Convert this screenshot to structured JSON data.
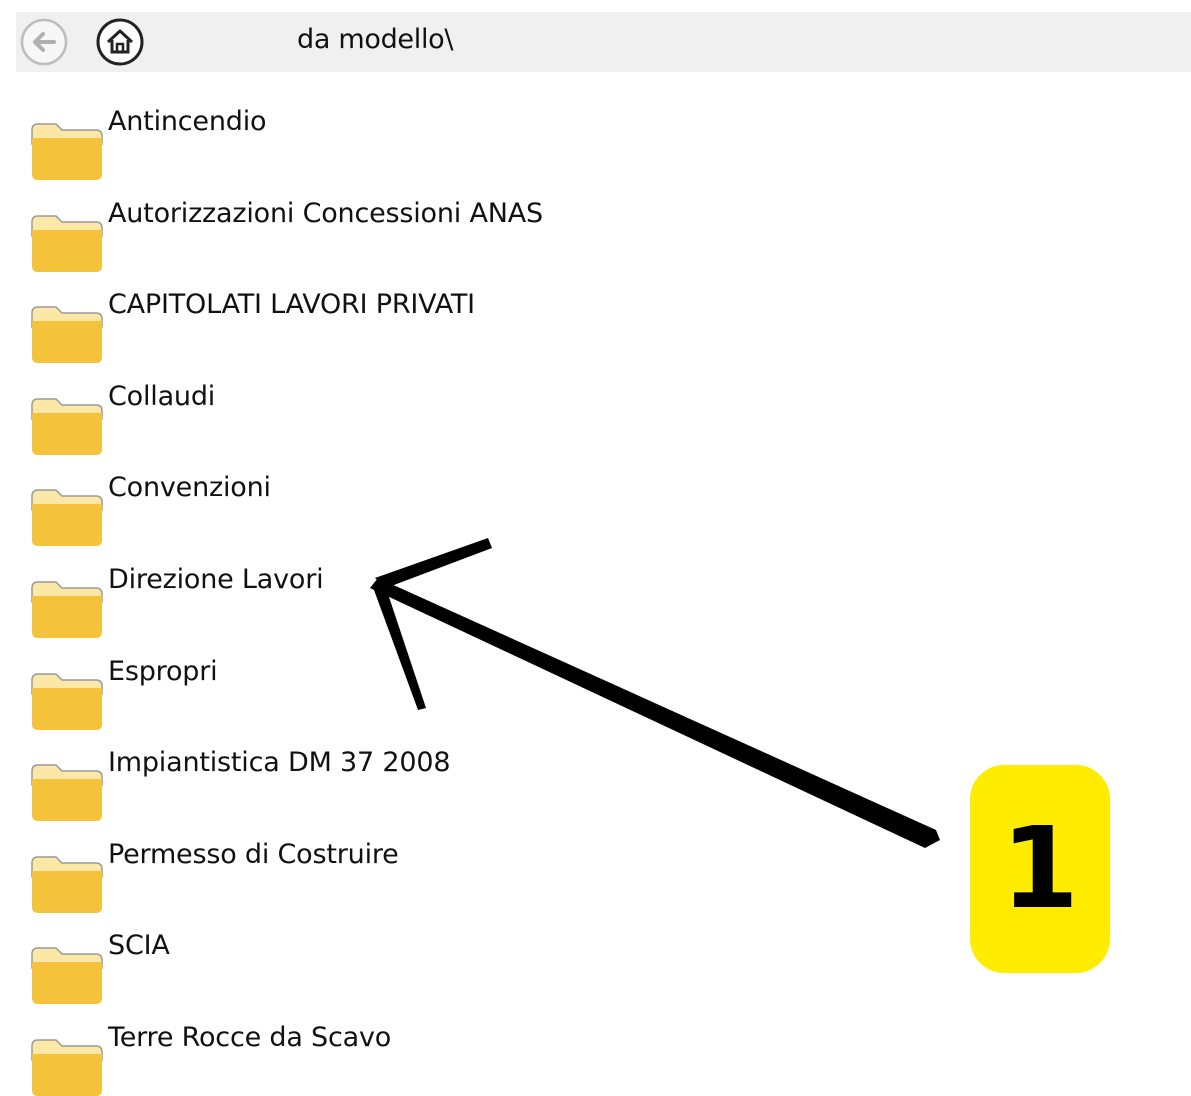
{
  "toolbar": {
    "back_icon": "back-arrow-icon",
    "home_icon": "home-icon",
    "path": "da modello\\"
  },
  "folders": [
    {
      "label": "Antincendio",
      "icon": "folder-icon"
    },
    {
      "label": "Autorizzazioni Concessioni ANAS",
      "icon": "folder-icon"
    },
    {
      "label": "CAPITOLATI LAVORI PRIVATI",
      "icon": "folder-icon"
    },
    {
      "label": "Collaudi",
      "icon": "folder-icon"
    },
    {
      "label": "Convenzioni",
      "icon": "folder-icon"
    },
    {
      "label": "Direzione Lavori",
      "icon": "folder-icon"
    },
    {
      "label": "Espropri",
      "icon": "folder-icon"
    },
    {
      "label": "Impiantistica DM 37 2008",
      "icon": "folder-icon"
    },
    {
      "label": "Permesso di Costruire",
      "icon": "folder-icon"
    },
    {
      "label": "SCIA",
      "icon": "folder-icon"
    },
    {
      "label": "Terre  Rocce da Scavo",
      "icon": "folder-icon"
    }
  ],
  "annotation": {
    "step_number": "1",
    "badge_color": "#ffec00",
    "arrow_target": "Direzione Lavori"
  },
  "colors": {
    "toolbar_bg": "#f0f0f0",
    "folder_fill": "#f5c33b",
    "folder_light": "#fbe7a6"
  }
}
